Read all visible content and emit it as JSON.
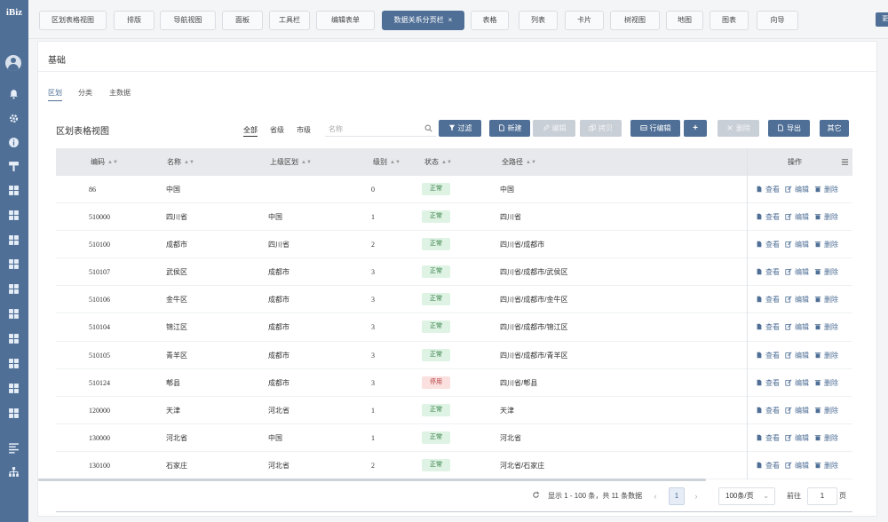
{
  "app": {
    "logo": "iBiz"
  },
  "sidebar": {
    "icons": [
      "user-icon",
      "bell-icon",
      "gear-icon",
      "info-icon",
      "brush-icon",
      "grid-icon",
      "grid-icon",
      "grid-icon",
      "grid-icon",
      "grid-icon",
      "grid-icon",
      "grid-icon",
      "grid-icon",
      "grid-icon",
      "grid-icon",
      "align-icon",
      "sitemap-icon"
    ]
  },
  "topnav": {
    "tabs": [
      {
        "label": "区划表格视图"
      },
      {
        "label": "排版"
      },
      {
        "label": "导航视图"
      },
      {
        "label": "面板"
      },
      {
        "label": "工具栏"
      },
      {
        "label": "编辑表单"
      },
      {
        "label": "数据关系分页栏",
        "close": "×"
      },
      {
        "label": "表格"
      },
      {
        "label": "列表"
      },
      {
        "label": "卡片"
      },
      {
        "label": "树视图"
      },
      {
        "label": "地图"
      },
      {
        "label": "图表"
      },
      {
        "label": "向导"
      }
    ],
    "more_label": "更多 ↓"
  },
  "page": {
    "title": "基础",
    "subtabs": [
      "区划",
      "分类",
      "主数据"
    ],
    "view_title": "区划表格视图",
    "quick_filters": [
      "全部",
      "省级",
      "市级"
    ],
    "search": {
      "placeholder": "名称"
    },
    "toolbar": {
      "filter": "过滤",
      "new": "新建",
      "edit": "编辑",
      "copy": "拷贝",
      "row_edit": "行编辑",
      "add": "+",
      "delete": "删除",
      "export": "导出",
      "other": "其它"
    }
  },
  "table": {
    "columns": {
      "code": "编码",
      "name": "名称",
      "parent": "上级区划",
      "level": "级别",
      "status": "状态",
      "path": "全路径",
      "ops": "操作"
    },
    "rows": [
      {
        "code": "86",
        "name": "中国",
        "parent": "",
        "level": "0",
        "status": "正常",
        "path": "中国"
      },
      {
        "code": "510000",
        "name": "四川省",
        "parent": "中国",
        "level": "1",
        "status": "正常",
        "path": "四川省"
      },
      {
        "code": "510100",
        "name": "成都市",
        "parent": "四川省",
        "level": "2",
        "status": "正常",
        "path": "四川省/成都市"
      },
      {
        "code": "510107",
        "name": "武侯区",
        "parent": "成都市",
        "level": "3",
        "status": "正常",
        "path": "四川省/成都市/武侯区"
      },
      {
        "code": "510106",
        "name": "金牛区",
        "parent": "成都市",
        "level": "3",
        "status": "正常",
        "path": "四川省/成都市/金牛区"
      },
      {
        "code": "510104",
        "name": "锦江区",
        "parent": "成都市",
        "level": "3",
        "status": "正常",
        "path": "四川省/成都市/锦江区"
      },
      {
        "code": "510105",
        "name": "青羊区",
        "parent": "成都市",
        "level": "3",
        "status": "正常",
        "path": "四川省/成都市/青羊区"
      },
      {
        "code": "510124",
        "name": "郫县",
        "parent": "成都市",
        "level": "3",
        "status": "停用",
        "path": "四川省/郫县"
      },
      {
        "code": "120000",
        "name": "天津",
        "parent": "河北省",
        "level": "1",
        "status": "正常",
        "path": "天津"
      },
      {
        "code": "130000",
        "name": "河北省",
        "parent": "中国",
        "level": "1",
        "status": "正常",
        "path": "河北省"
      },
      {
        "code": "130100",
        "name": "石家庄",
        "parent": "河北省",
        "level": "2",
        "status": "正常",
        "path": "河北省/石家庄"
      }
    ],
    "row_actions": {
      "view": "查看",
      "edit": "编辑",
      "delete": "删除"
    }
  },
  "pagination": {
    "summary": "显示 1 - 100 条，共 11 条数据",
    "prev": "‹",
    "current_page": "1",
    "next": "›",
    "page_size": "100条/页",
    "page_size_caret": "⌄",
    "goto_label": "前往",
    "goto_value": "1",
    "page_suffix": "页"
  },
  "colors": {
    "primary": "#4f6f96",
    "ok_bg": "#dff3e4",
    "stop_bg": "#fbe0e0"
  }
}
